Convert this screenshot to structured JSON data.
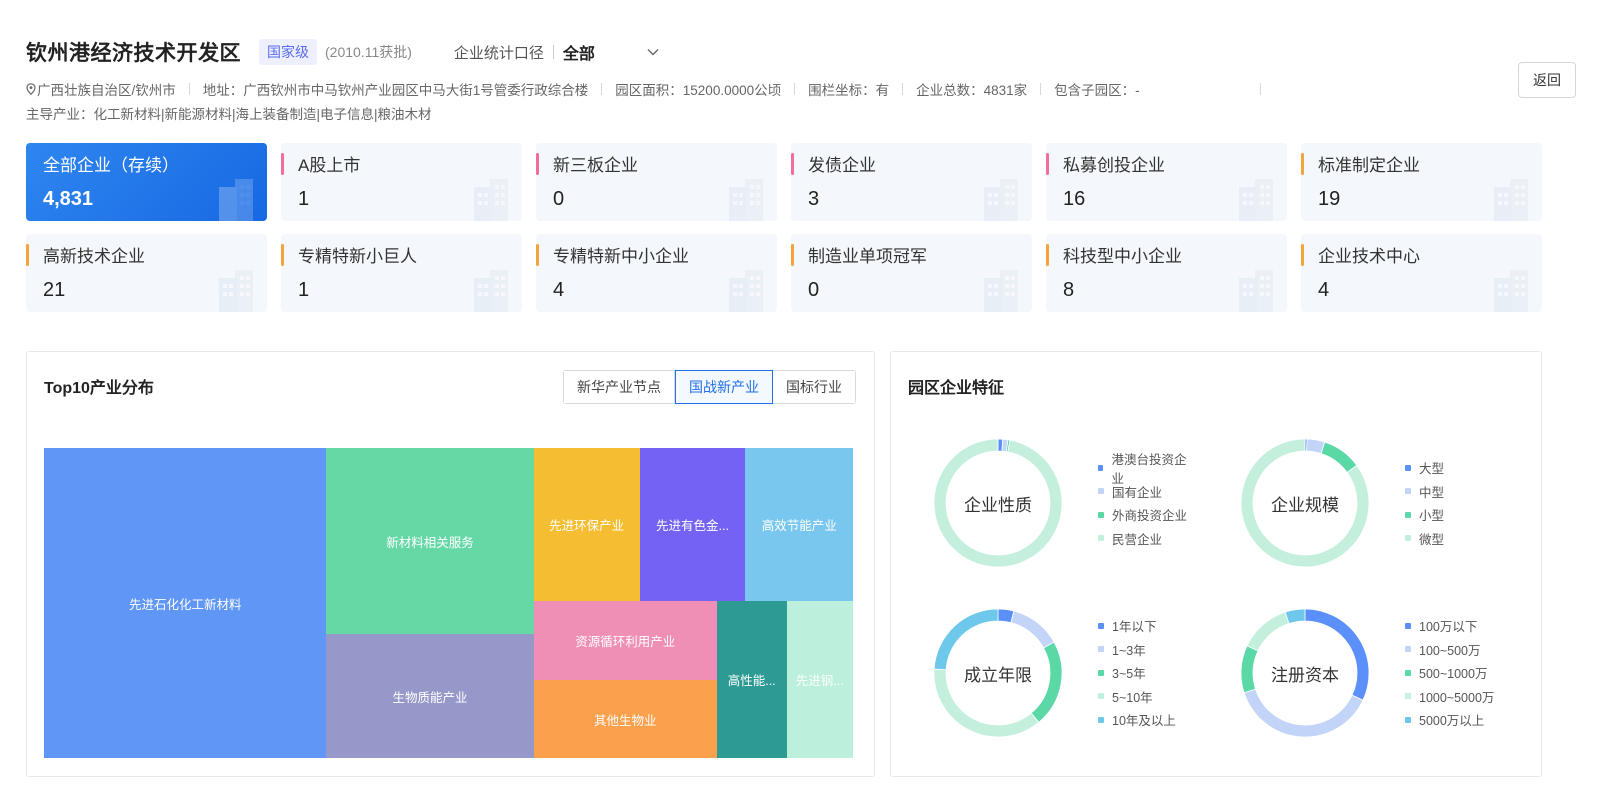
{
  "header": {
    "title": "钦州港经济技术开发区",
    "level": "国家级",
    "approved": "(2010.11获批)",
    "stat_label": "企业统计口径",
    "stat_value": "全部",
    "return_label": "返回",
    "region": "广西壮族自治区/钦州市",
    "address": "地址：广西钦州市中马钦州产业园区中马大街1号管委行政综合楼",
    "area": "园区面积：15200.0000公顷",
    "fence": "围栏坐标：有",
    "total": "企业总数：4831家",
    "subpark": "包含子园区：-",
    "industry": "主导产业：化工新材料|新能源材料|海上装备制造|电子信息|粮油木材"
  },
  "cards": [
    {
      "label": "全部企业（存续）",
      "value": "4,831",
      "color": "#ffffff",
      "active": true
    },
    {
      "label": "A股上市",
      "value": "1",
      "color": "#ef6f9a"
    },
    {
      "label": "新三板企业",
      "value": "0",
      "color": "#ef6f9a"
    },
    {
      "label": "发债企业",
      "value": "3",
      "color": "#ef6f9a"
    },
    {
      "label": "私募创投企业",
      "value": "16",
      "color": "#ef6f9a"
    },
    {
      "label": "标准制定企业",
      "value": "19",
      "color": "#f5a33b"
    },
    {
      "label": "高新技术企业",
      "value": "21",
      "color": "#f5a33b"
    },
    {
      "label": "专精特新小巨人",
      "value": "1",
      "color": "#f5a33b"
    },
    {
      "label": "专精特新中小企业",
      "value": "4",
      "color": "#f5a33b"
    },
    {
      "label": "制造业单项冠军",
      "value": "0",
      "color": "#f5a33b"
    },
    {
      "label": "科技型中小企业",
      "value": "8",
      "color": "#f5a33b"
    },
    {
      "label": "企业技术中心",
      "value": "4",
      "color": "#f5a33b"
    }
  ],
  "industry_panel": {
    "title": "Top10产业分布",
    "tabs": [
      {
        "label": "新华产业节点",
        "active": false
      },
      {
        "label": "国战新产业",
        "active": true
      },
      {
        "label": "国标行业",
        "active": false
      }
    ]
  },
  "features_panel": {
    "title": "园区企业特征"
  },
  "chart_data": [
    {
      "type": "treemap",
      "title": "Top10产业分布",
      "categories": [
        "先进石化化工新材料",
        "新材料相关服务",
        "生物质能产业",
        "先进环保产业",
        "先进有色金...",
        "高效节能产业",
        "资源循环利用产业",
        "其他生物业",
        "高性能...",
        "先进钢..."
      ],
      "values": [
        34.5,
        15.2,
        10.1,
        6.4,
        6.4,
        6.5,
        5.7,
        5.6,
        4.3,
        4.1
      ],
      "colors": [
        "#6096f5",
        "#66d8a6",
        "#9598c9",
        "#f5bd31",
        "#7462f5",
        "#79c7ee",
        "#f08fb6",
        "#fba04c",
        "#2e9a94",
        "#bdf0dc"
      ]
    },
    {
      "type": "pie",
      "title": "企业性质",
      "categories": [
        "港澳台投资企业",
        "国有企业",
        "外商投资企业",
        "民营企业"
      ],
      "values": [
        1.2,
        1.3,
        0.5,
        97.0
      ],
      "colors": [
        "#5b8ff9",
        "#c3d4f9",
        "#5ad8a6",
        "#c4efdd"
      ]
    },
    {
      "type": "pie",
      "title": "企业规模",
      "categories": [
        "大型",
        "中型",
        "小型",
        "微型"
      ],
      "values": [
        0.5,
        4.5,
        10.0,
        85.0
      ],
      "colors": [
        "#5b8ff9",
        "#c3d4f9",
        "#5ad8a6",
        "#c4efdd"
      ]
    },
    {
      "type": "pie",
      "title": "成立年限",
      "categories": [
        "1年以下",
        "1~3年",
        "3~5年",
        "5~10年",
        "10年及以上"
      ],
      "values": [
        4,
        13,
        22,
        37,
        24
      ],
      "colors": [
        "#5b8ff9",
        "#c3d4f9",
        "#5ad8a6",
        "#c4efdd",
        "#6dc8ec"
      ]
    },
    {
      "type": "pie",
      "title": "注册资本",
      "categories": [
        "100万以下",
        "100~500万",
        "500~1000万",
        "1000~5000万",
        "5000万以上"
      ],
      "values": [
        32,
        38,
        12,
        13,
        5
      ],
      "colors": [
        "#5b8ff9",
        "#c3d4f9",
        "#5ad8a6",
        "#c4efdd",
        "#6dc8ec"
      ]
    }
  ]
}
